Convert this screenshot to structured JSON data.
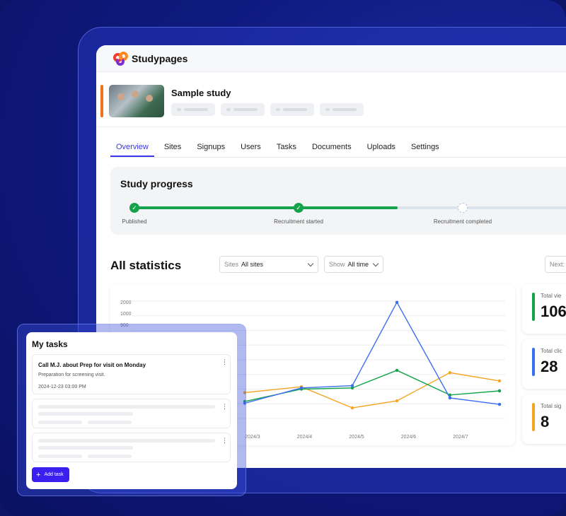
{
  "brand": {
    "name": "Studypages"
  },
  "study": {
    "title": "Sample study"
  },
  "tabs": [
    {
      "label": "Overview",
      "active": true
    },
    {
      "label": "Sites"
    },
    {
      "label": "Signups"
    },
    {
      "label": "Users"
    },
    {
      "label": "Tasks"
    },
    {
      "label": "Documents"
    },
    {
      "label": "Uploads"
    },
    {
      "label": "Settings"
    }
  ],
  "progress": {
    "title": "Study progress",
    "steps": [
      {
        "label": "Published",
        "status": "done"
      },
      {
        "label": "Recruitment started",
        "status": "done"
      },
      {
        "label": "Recruitment completed",
        "status": "pending"
      }
    ]
  },
  "statistics": {
    "title": "All statistics",
    "sites_filter": {
      "label": "Sites",
      "value": "All sites"
    },
    "show_filter": {
      "label": "Show",
      "value": "All time"
    },
    "next_button": "Next:"
  },
  "chart_data": {
    "type": "line",
    "y_ticks": [
      "2000",
      "1000",
      "900"
    ],
    "x_ticks": [
      "2024/3",
      "2024/4",
      "2024/5",
      "2024/6",
      "2024/7"
    ],
    "series": [
      {
        "color": "#f5a524",
        "values": [
          440,
          540,
          180,
          300,
          780,
          640
        ]
      },
      {
        "color": "#14a34a",
        "values": [
          290,
          500,
          520,
          820,
          400,
          470
        ]
      },
      {
        "color": "#3b6ef0",
        "values": [
          260,
          520,
          560,
          1980,
          350,
          240
        ]
      }
    ]
  },
  "metrics": [
    {
      "label": "Total vie",
      "value": "106",
      "color": "#14a34a"
    },
    {
      "label": "Total clic",
      "value": "28",
      "color": "#3b6ef0"
    },
    {
      "label": "Total sig",
      "value": "8",
      "color": "#f5a524"
    }
  ],
  "tasks": {
    "title": "My tasks",
    "items": [
      {
        "name": "Call M.J. about Prep for visit on Monday",
        "description": "Preparation for screening visit.",
        "datetime": "2024-12-23  03:00 PM"
      }
    ],
    "add_label": "Add task"
  },
  "colors": {
    "accent": "#3a35e6",
    "success": "#14a34a",
    "button": "#3a1ff0"
  }
}
